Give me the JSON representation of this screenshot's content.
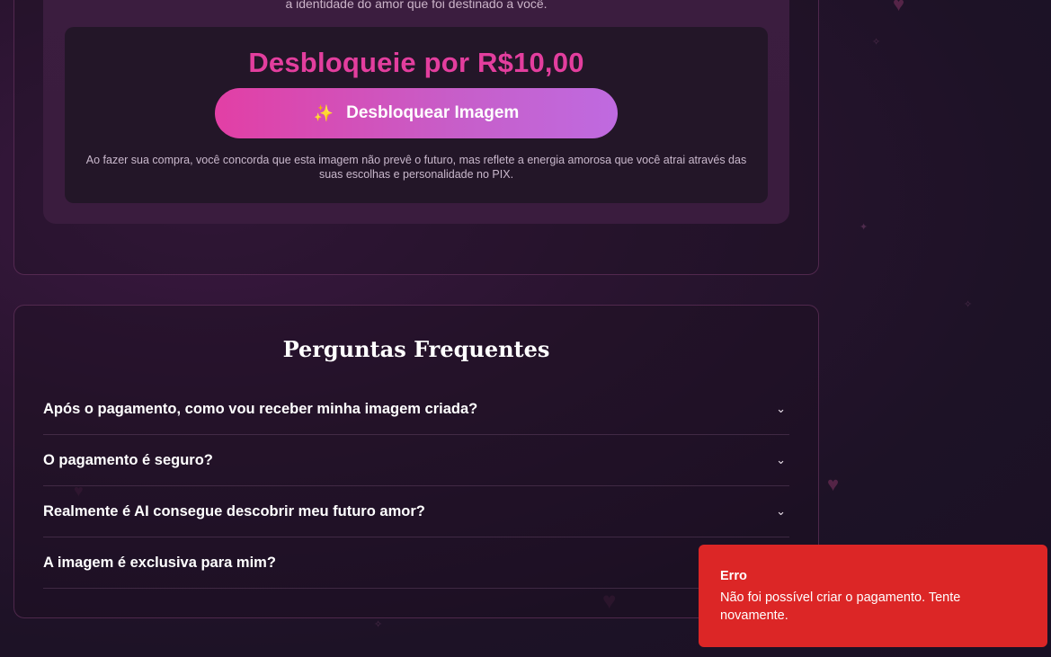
{
  "offer": {
    "intro_text": "a identidade do amor que foi destinado a você.",
    "price_text": "Desbloqueie por R$10,00",
    "button_label": "Desbloquear Imagem",
    "button_icon": "sparkles-icon",
    "disclaimer": "Ao fazer sua compra, você concorda que esta imagem não prevê o futuro, mas reflete a energia amorosa que você atrai através das suas escolhas e personalidade no PIX.",
    "accent_color": "#e33e9e"
  },
  "faq": {
    "title": "Perguntas Frequentes",
    "items": [
      {
        "question": "Após o pagamento, como vou receber minha imagem criada?"
      },
      {
        "question": "O pagamento é seguro?"
      },
      {
        "question": "Realmente é AI consegue descobrir meu futuro amor?"
      },
      {
        "question": "A imagem é exclusiva para mim?"
      }
    ],
    "expand_icon": "chevron-down-icon"
  },
  "toast": {
    "title": "Erro",
    "message": "Não foi possível criar o pagamento. Tente novamente.",
    "color": "#dc2626"
  }
}
